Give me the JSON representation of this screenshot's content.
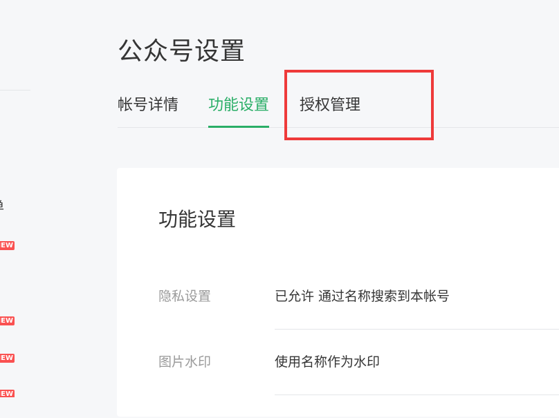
{
  "sidebar": {
    "partial_text": "单",
    "badge_label": "NEW"
  },
  "page": {
    "title": "公众号设置"
  },
  "tabs": [
    {
      "label": "帐号详情",
      "active": false
    },
    {
      "label": "功能设置",
      "active": true
    },
    {
      "label": "授权管理",
      "active": false
    }
  ],
  "card": {
    "title": "功能设置",
    "rows": [
      {
        "label": "隐私设置",
        "value": "已允许 通过名称搜索到本帐号"
      },
      {
        "label": "图片水印",
        "value": "使用名称作为水印"
      }
    ]
  },
  "colors": {
    "accent": "#2aae67",
    "highlight": "#ee3a3a",
    "badge": "#fa5151"
  }
}
